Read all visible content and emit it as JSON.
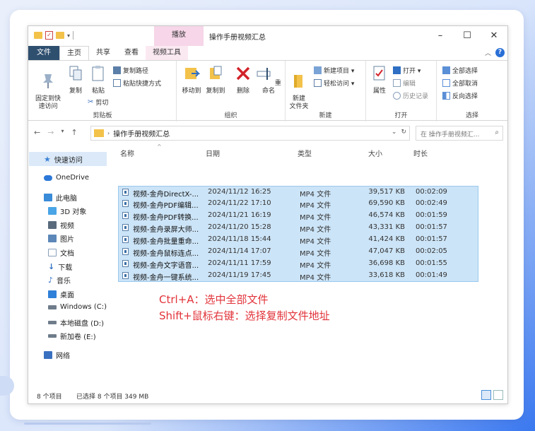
{
  "window": {
    "title": "操作手册视频汇总",
    "context_tab": "播放"
  },
  "controls": {
    "minimize": "–",
    "maximize": "☐",
    "close": "✕"
  },
  "tabs": [
    "文件",
    "主页",
    "共享",
    "查看",
    "视频工具"
  ],
  "ribbon": {
    "clipboard": {
      "label": "剪贴板",
      "pin": "固定到快\n速访问",
      "copy": "复制",
      "paste": "粘贴",
      "copy_path": "复制路径",
      "paste_shortcut": "粘贴快捷方式",
      "cut": "剪切"
    },
    "organize": {
      "label": "组织",
      "move_to": "移动到",
      "copy_to": "复制到",
      "delete": "删除",
      "rename": "重命名"
    },
    "new": {
      "label": "新建",
      "new_folder": "新建\n文件夹",
      "new_item": "新建项目 ▾",
      "easy_access": "轻松访问 ▾"
    },
    "open": {
      "label": "打开",
      "properties": "属性",
      "open": "打开 ▾",
      "edit": "编辑",
      "history": "历史记录"
    },
    "select": {
      "label": "选择",
      "select_all": "全部选择",
      "select_none": "全部取消",
      "invert": "反向选择"
    }
  },
  "address": {
    "path": "操作手册视频汇总",
    "search_placeholder": "在 操作手册视频汇..."
  },
  "nav_pane": [
    {
      "label": "快速访问",
      "icon": "star-icon",
      "color": "#3b82d6"
    },
    {
      "label": "OneDrive",
      "icon": "cloud-icon",
      "color": "#2b78d8"
    },
    {
      "label": "此电脑",
      "icon": "computer-icon",
      "color": "#3a8bd8"
    },
    {
      "label": "3D 对象",
      "icon": "cube-icon",
      "color": "#49a5e6"
    },
    {
      "label": "视频",
      "icon": "video-icon",
      "color": "#5a6b7d"
    },
    {
      "label": "图片",
      "icon": "picture-icon",
      "color": "#5c87b8"
    },
    {
      "label": "文档",
      "icon": "document-icon",
      "color": "#8aa0bb"
    },
    {
      "label": "下载",
      "icon": "download-icon",
      "color": "#2f6fc4"
    },
    {
      "label": "音乐",
      "icon": "music-icon",
      "color": "#2f6fc4"
    },
    {
      "label": "桌面",
      "icon": "desktop-icon",
      "color": "#2f80d8"
    },
    {
      "label": "Windows (C:)",
      "icon": "drive-c-icon",
      "color": "#6f7c8a"
    },
    {
      "label": "本地磁盘 (D:)",
      "icon": "drive-icon",
      "color": "#6f7c8a"
    },
    {
      "label": "新加卷 (E:)",
      "icon": "drive-icon",
      "color": "#6f7c8a"
    },
    {
      "label": "网络",
      "icon": "network-icon",
      "color": "#3a70c0"
    }
  ],
  "columns": {
    "name": "名称",
    "date": "日期",
    "type": "类型",
    "size": "大小",
    "duration": "时长"
  },
  "files": [
    {
      "name": "视频-金舟DirectX-...",
      "date": "2024/11/12 16:25",
      "type": "MP4 文件",
      "size": "39,517 KB",
      "duration": "00:02:09"
    },
    {
      "name": "视频-金舟PDF编辑...",
      "date": "2024/11/22 17:10",
      "type": "MP4 文件",
      "size": "69,590 KB",
      "duration": "00:02:49"
    },
    {
      "name": "视频-金舟PDF转换...",
      "date": "2024/11/21 16:19",
      "type": "MP4 文件",
      "size": "46,574 KB",
      "duration": "00:01:59"
    },
    {
      "name": "视频-金舟录屏大师...",
      "date": "2024/11/20 15:28",
      "type": "MP4 文件",
      "size": "43,331 KB",
      "duration": "00:01:57"
    },
    {
      "name": "视频-金舟批量重命...",
      "date": "2024/11/18 15:44",
      "type": "MP4 文件",
      "size": "41,424 KB",
      "duration": "00:01:57"
    },
    {
      "name": "视频-金舟鼠标连点...",
      "date": "2024/11/14 17:07",
      "type": "MP4 文件",
      "size": "47,047 KB",
      "duration": "00:02:05"
    },
    {
      "name": "视频-金舟文字语音...",
      "date": "2024/11/11 17:59",
      "type": "MP4 文件",
      "size": "36,698 KB",
      "duration": "00:01:55"
    },
    {
      "name": "视频-金舟一键系统...",
      "date": "2024/11/19 17:45",
      "type": "MP4 文件",
      "size": "33,618 KB",
      "duration": "00:01:49"
    }
  ],
  "annotation": {
    "line1": "Ctrl+A：选中全部文件",
    "line2": "Shift+鼠标右键：选择复制文件地址"
  },
  "status": {
    "count": "8 个项目",
    "selected": "已选择 8 个项目  349 MB"
  }
}
